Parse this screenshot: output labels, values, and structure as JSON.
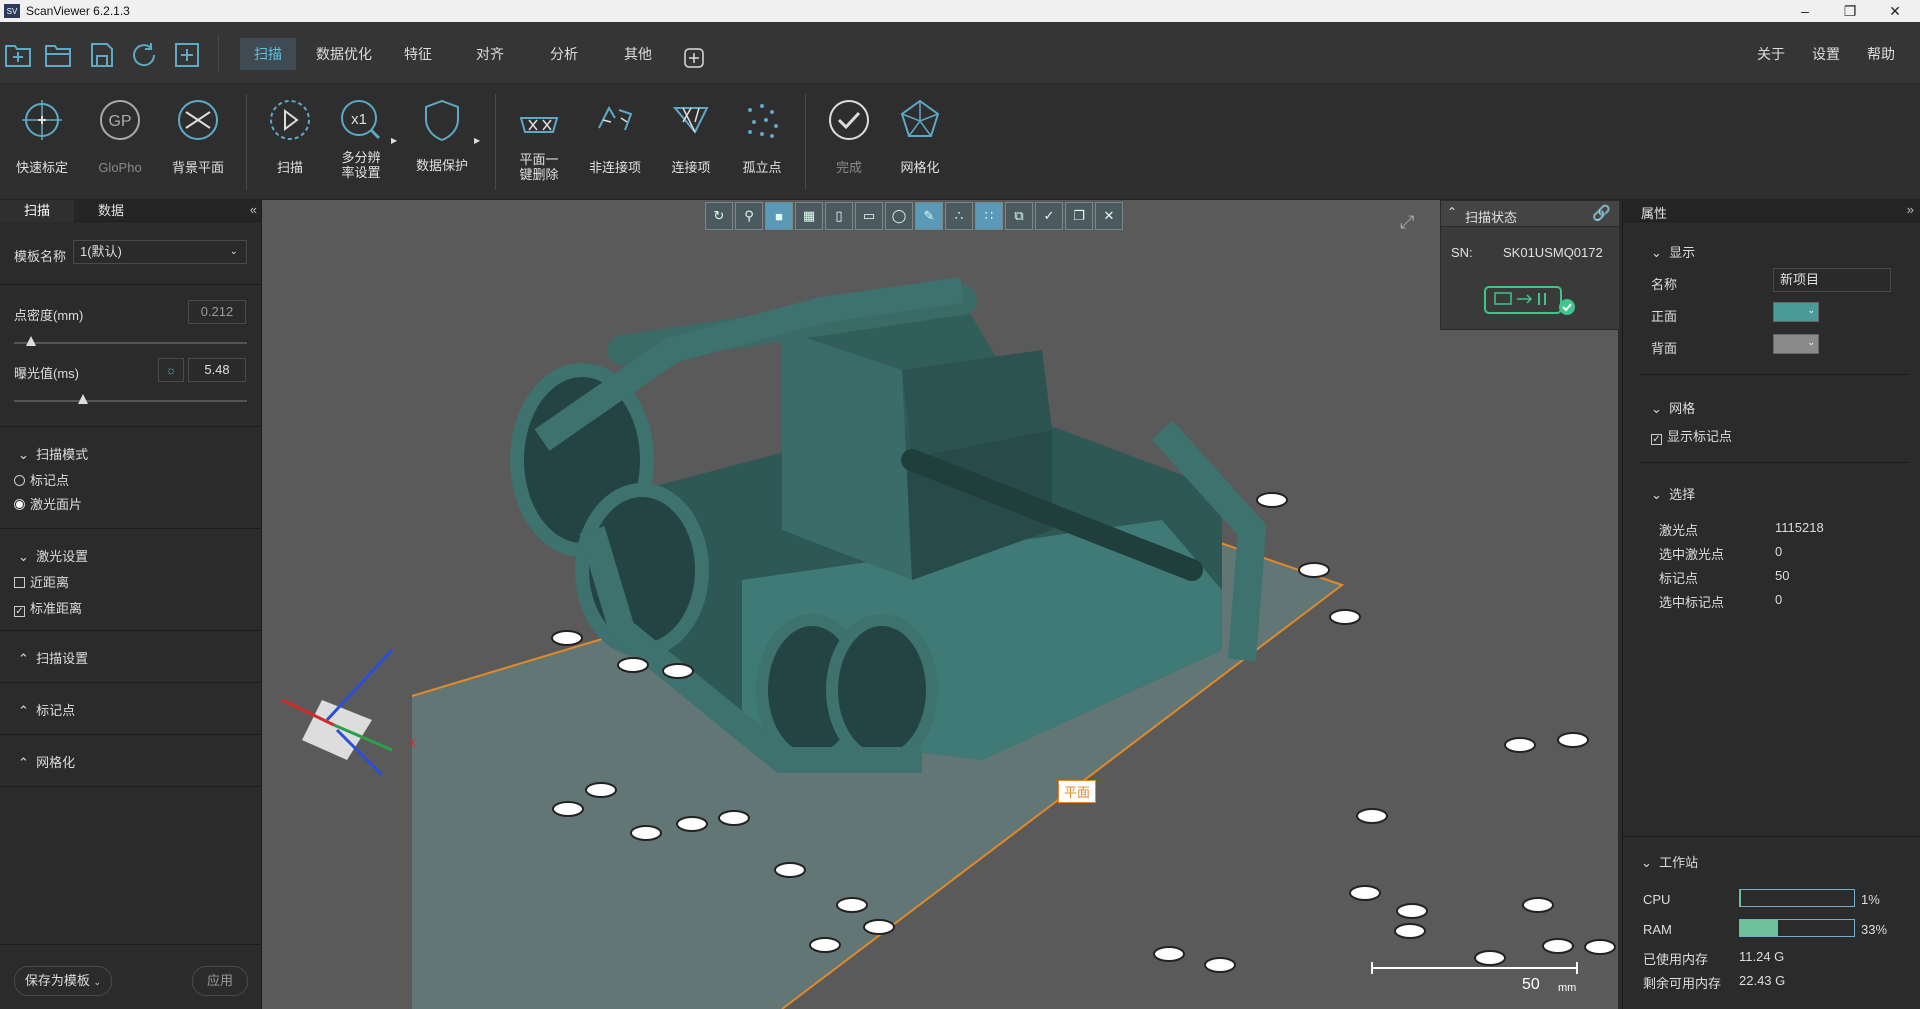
{
  "window": {
    "title": "ScanViewer 6.2.1.3",
    "logo": "SV"
  },
  "menu": {
    "tabs": [
      "扫描",
      "数据优化",
      "特征",
      "对齐",
      "分析",
      "其他"
    ],
    "active": "扫描",
    "right": [
      "关于",
      "设置",
      "帮助"
    ]
  },
  "toolbar": {
    "tools": [
      {
        "label": "快速标定",
        "icon": "calibrate-icon",
        "dim": false
      },
      {
        "label": "GloPho",
        "icon": "glopho-icon",
        "dim": true
      },
      {
        "label": "背景平面",
        "icon": "background-plane-icon",
        "dim": false
      },
      {
        "label": "扫描",
        "icon": "play-icon",
        "dim": false
      },
      {
        "label": "多分辨率设置",
        "icon": "multires-icon",
        "dim": false
      },
      {
        "label": "数据保护",
        "icon": "shield-icon",
        "dim": false
      },
      {
        "label": "平面一键删除",
        "icon": "plane-delete-icon",
        "dim": false
      },
      {
        "label": "非连接项",
        "icon": "disconnected-icon",
        "dim": false
      },
      {
        "label": "连接项",
        "icon": "connected-icon",
        "dim": false
      },
      {
        "label": "孤立点",
        "icon": "isolated-points-icon",
        "dim": false
      },
      {
        "label": "完成",
        "icon": "check-icon",
        "dim": true
      },
      {
        "label": "网格化",
        "icon": "mesh-icon",
        "dim": false
      }
    ],
    "multires_line1": "多分辨",
    "multires_line2": "率设置",
    "plane_line1": "平面一",
    "plane_line2": "键删除"
  },
  "left": {
    "tabs": [
      "扫描",
      "数据"
    ],
    "template_label": "模板名称",
    "template_value": "1(默认)",
    "density_label": "点密度(mm)",
    "density_value": "0.212",
    "density_level": 0.1,
    "exposure_label": "曝光值(ms)",
    "exposure_value": "5.48",
    "exposure_level": 0.3,
    "scan_mode": "扫描模式",
    "mode_marker": "标记点",
    "mode_laser": "激光面片",
    "laser_settings": "激光设置",
    "near": "近距离",
    "standard": "标准距离",
    "scan_settings": "扫描设置",
    "markers": "标记点",
    "meshing": "网格化",
    "save_template": "保存为模板",
    "apply": "应用"
  },
  "viewport": {
    "plane_label": "平面",
    "scale_value": "50",
    "scale_unit": "mm",
    "axis_x": "X"
  },
  "scan_status": {
    "title": "扫描状态",
    "sn_label": "SN:",
    "sn_value": "SK01USMQ0172"
  },
  "right": {
    "title": "属性",
    "display": "显示",
    "name_label": "名称",
    "name_value": "新项目",
    "front_label": "正面",
    "back_label": "背面",
    "front_color": "#4a9a9a",
    "back_color": "#8a8a8a",
    "grid": "网格",
    "show_markers": "显示标记点",
    "select": "选择",
    "stats": [
      [
        "激光点",
        "1115218"
      ],
      [
        "选中激光点",
        "0"
      ],
      [
        "标记点",
        "50"
      ],
      [
        "选中标记点",
        "0"
      ]
    ],
    "workstation": "工作站",
    "cpu_label": "CPU",
    "cpu_value": "1%",
    "cpu_level": 0.01,
    "ram_label": "RAM",
    "ram_value": "33%",
    "ram_level": 0.33,
    "used_label": "已使用内存",
    "used_value": "11.24 G",
    "free_label": "剩余可用内存",
    "free_value": "22.43 G"
  }
}
